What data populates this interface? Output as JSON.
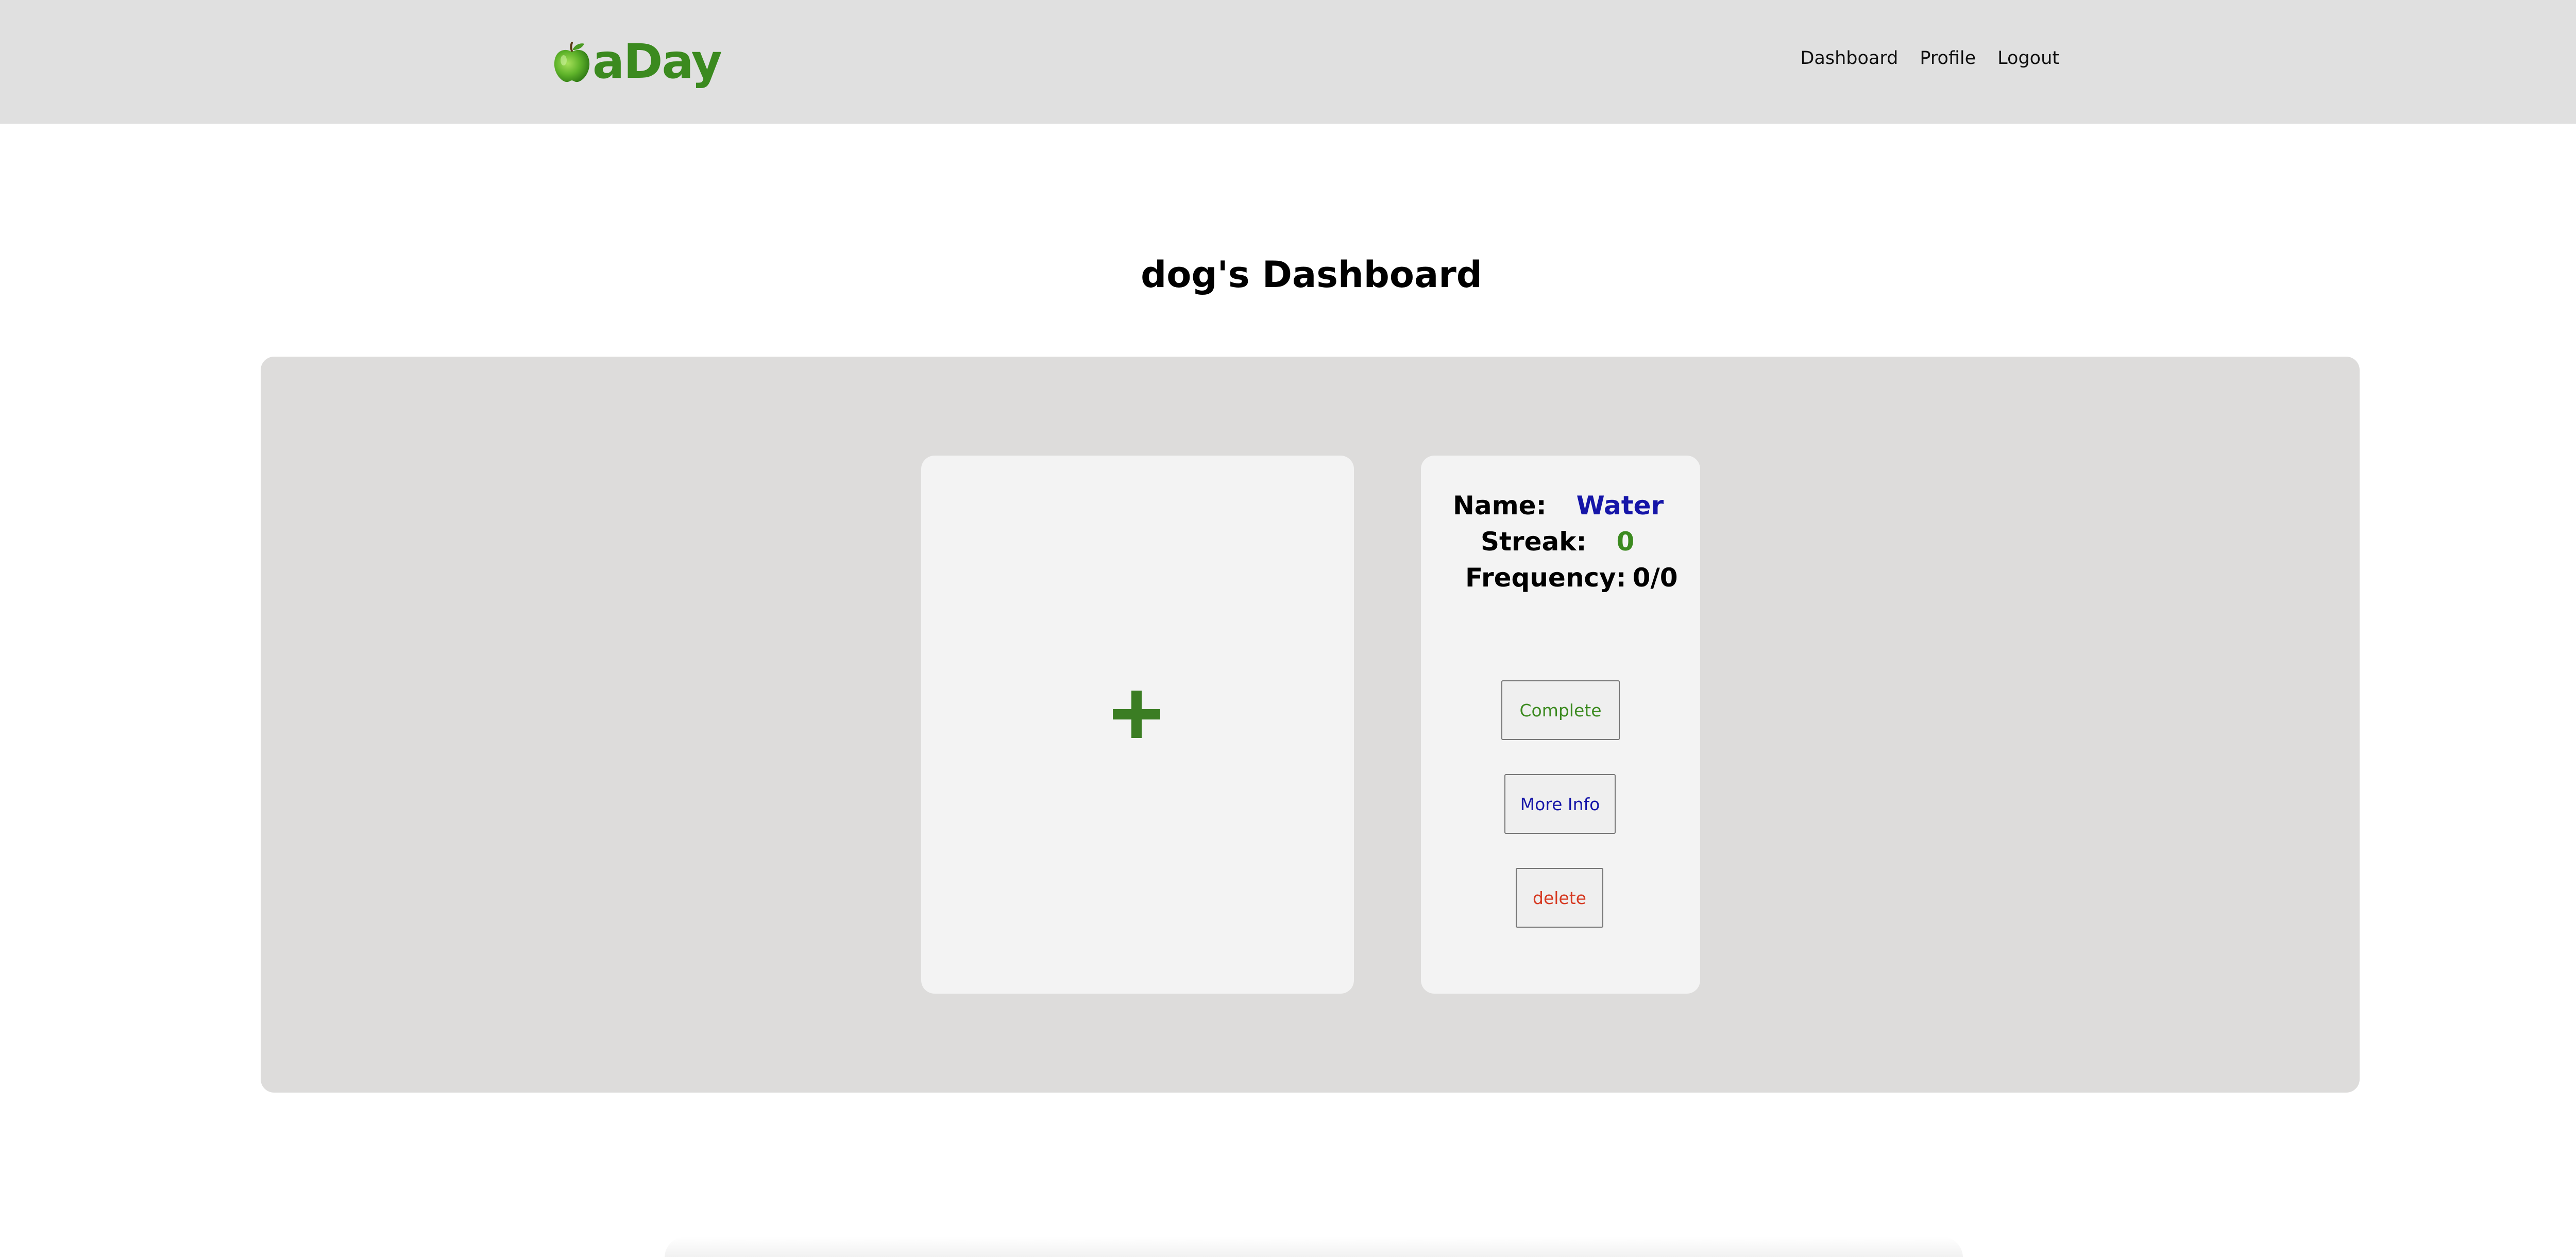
{
  "header": {
    "logo_text": "aDay",
    "logo_icon": "green-apple-icon",
    "nav": [
      {
        "label": "Dashboard"
      },
      {
        "label": "Profile"
      },
      {
        "label": "Logout"
      }
    ]
  },
  "main": {
    "title": "dog's Dashboard",
    "add_card": {
      "icon": "plus-icon"
    },
    "habit": {
      "name_label": "Name:",
      "name_value": "Water",
      "streak_label": "Streak:",
      "streak_value": "0",
      "frequency_label": "Frequency:",
      "frequency_value": "0/0",
      "complete_label": "Complete",
      "more_info_label": "More Info",
      "delete_label": "delete"
    }
  },
  "colors": {
    "brand_green": "#3b8a1f",
    "header_bg": "#e0e0e0",
    "panel_bg": "#dddcdb",
    "card_bg": "#f3f3f3",
    "name_blue": "#1515a8",
    "delete_red": "#d63a22"
  }
}
